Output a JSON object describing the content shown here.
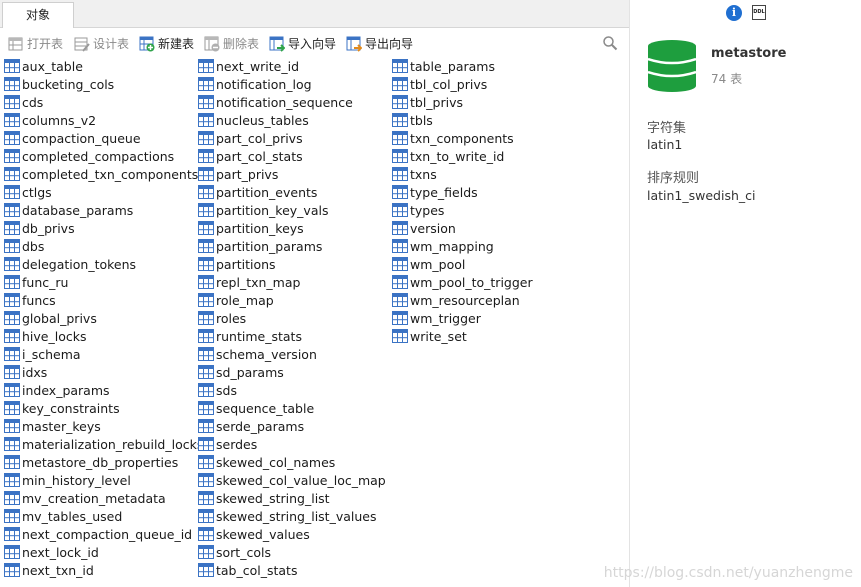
{
  "tabs": [
    {
      "label": "对象"
    }
  ],
  "toolbar": {
    "open_table": "打开表",
    "design_table": "设计表",
    "new_table": "新建表",
    "delete_table": "删除表",
    "import_wizard": "导入向导",
    "export_wizard": "导出向导"
  },
  "tables": {
    "col1": [
      "aux_table",
      "bucketing_cols",
      "cds",
      "columns_v2",
      "compaction_queue",
      "completed_compactions",
      "completed_txn_components",
      "ctlgs",
      "database_params",
      "db_privs",
      "dbs",
      "delegation_tokens",
      "func_ru",
      "funcs",
      "global_privs",
      "hive_locks",
      "i_schema",
      "idxs",
      "index_params",
      "key_constraints",
      "master_keys",
      "materialization_rebuild_locks",
      "metastore_db_properties",
      "min_history_level",
      "mv_creation_metadata",
      "mv_tables_used",
      "next_compaction_queue_id",
      "next_lock_id",
      "next_txn_id"
    ],
    "col2": [
      "next_write_id",
      "notification_log",
      "notification_sequence",
      "nucleus_tables",
      "part_col_privs",
      "part_col_stats",
      "part_privs",
      "partition_events",
      "partition_key_vals",
      "partition_keys",
      "partition_params",
      "partitions",
      "repl_txn_map",
      "role_map",
      "roles",
      "runtime_stats",
      "schema_version",
      "sd_params",
      "sds",
      "sequence_table",
      "serde_params",
      "serdes",
      "skewed_col_names",
      "skewed_col_value_loc_map",
      "skewed_string_list",
      "skewed_string_list_values",
      "skewed_values",
      "sort_cols",
      "tab_col_stats"
    ],
    "col3": [
      "table_params",
      "tbl_col_privs",
      "tbl_privs",
      "tbls",
      "txn_components",
      "txn_to_write_id",
      "txns",
      "type_fields",
      "types",
      "version",
      "wm_mapping",
      "wm_pool",
      "wm_pool_to_trigger",
      "wm_resourceplan",
      "wm_trigger",
      "write_set"
    ]
  },
  "info": {
    "db_name": "metastore",
    "table_count": "74 表",
    "charset_label": "字符集",
    "charset_value": "latin1",
    "collation_label": "排序规则",
    "collation_value": "latin1_swedish_ci",
    "ddl_icon_text": "DDL"
  },
  "watermark": "https://blog.csdn.net/yuanzhengme",
  "colors": {
    "db_green": "#1e9e3e",
    "table_icon_blue": "#3b73c4",
    "info_blue": "#1f6fd1"
  }
}
